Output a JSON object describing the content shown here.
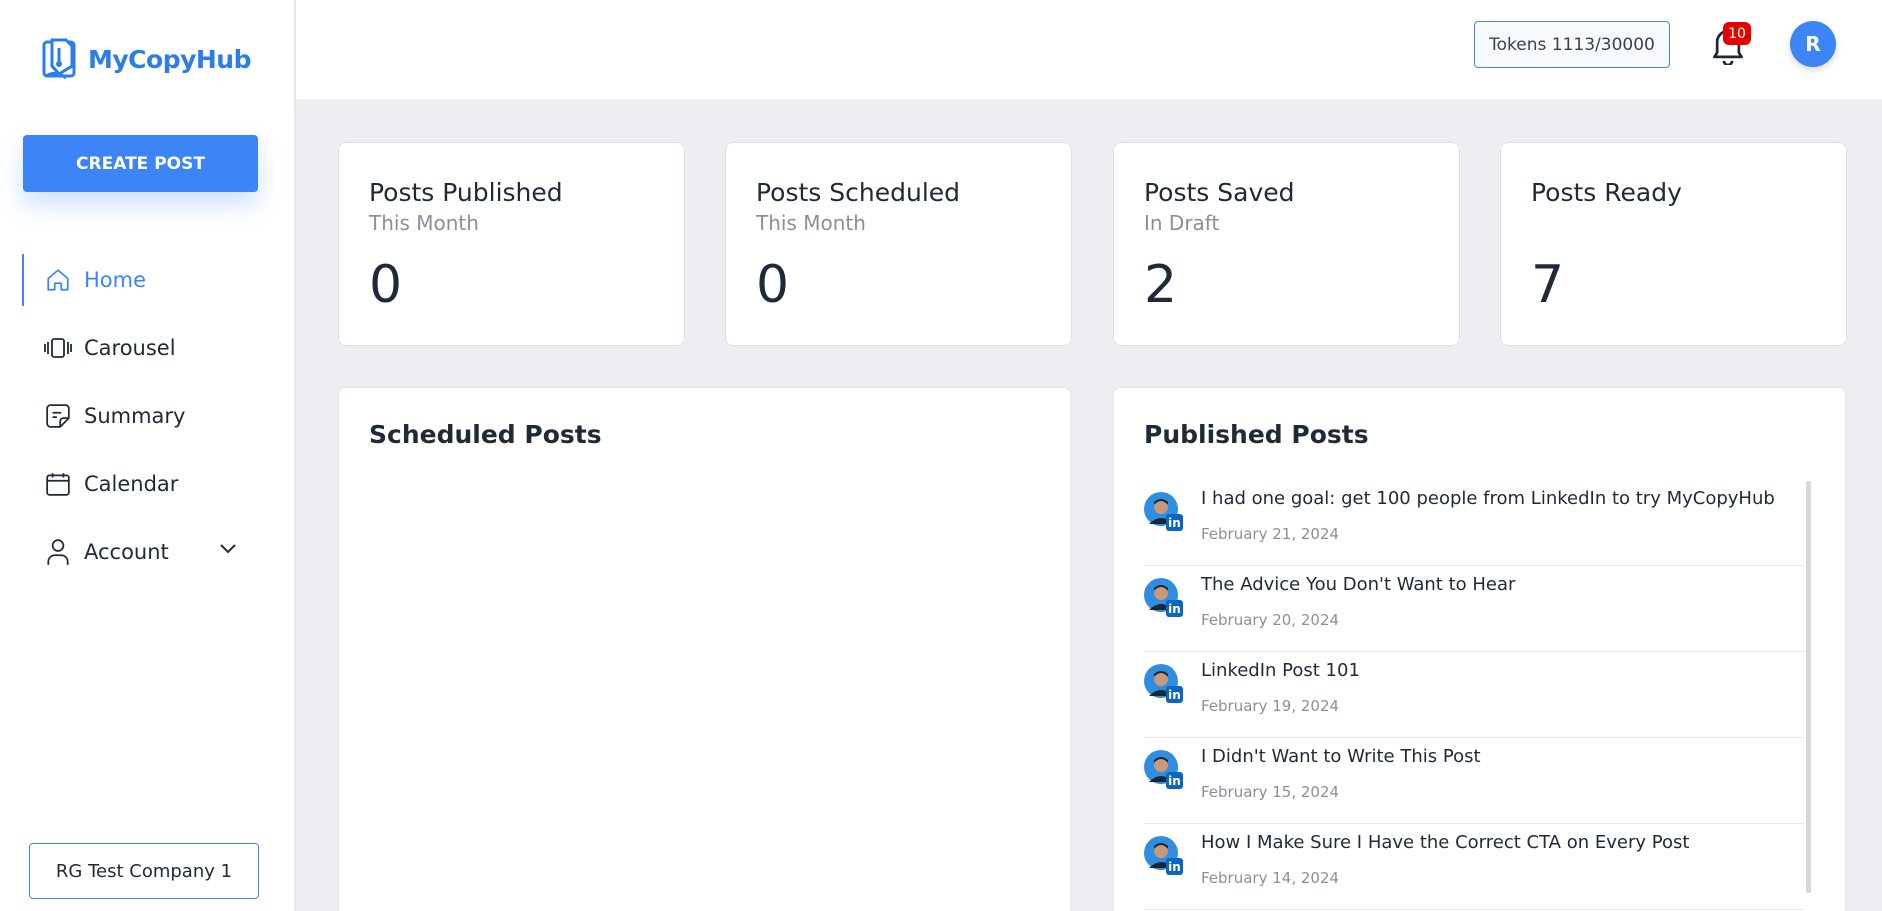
{
  "app": {
    "name": "MyCopyHub",
    "brand_color": "#2b7de9",
    "accent": "#3d84f7"
  },
  "sidebar": {
    "create_label": "CREATE POST",
    "items": [
      {
        "label": "Home",
        "icon": "home-icon",
        "active": true
      },
      {
        "label": "Carousel",
        "icon": "carousel-icon"
      },
      {
        "label": "Summary",
        "icon": "summary-icon"
      },
      {
        "label": "Calendar",
        "icon": "calendar-icon"
      },
      {
        "label": "Account",
        "icon": "user-icon",
        "expandable": true
      }
    ],
    "company": "RG Test Company 1"
  },
  "header": {
    "tokens": "Tokens 1113/30000",
    "notifications": "10",
    "avatar_initial": "R"
  },
  "stats": [
    {
      "title": "Posts Published",
      "subtitle": "This Month",
      "value": "0"
    },
    {
      "title": "Posts Scheduled",
      "subtitle": "This Month",
      "value": "0"
    },
    {
      "title": "Posts Saved",
      "subtitle": "In Draft",
      "value": "2"
    },
    {
      "title": "Posts Ready",
      "subtitle": "",
      "value": "7"
    }
  ],
  "scheduled": {
    "title": "Scheduled Posts"
  },
  "published": {
    "title": "Published Posts",
    "posts": [
      {
        "title": "I had one goal: get 100 people from LinkedIn to try MyCopyHub",
        "date": "February 21, 2024"
      },
      {
        "title": "The Advice You Don't Want to Hear",
        "date": "February 20, 2024"
      },
      {
        "title": "LinkedIn Post 101",
        "date": "February 19, 2024"
      },
      {
        "title": "I Didn't Want to Write This Post",
        "date": "February 15, 2024"
      },
      {
        "title": "How I Make Sure I Have the Correct CTA on Every Post",
        "date": "February 14, 2024"
      }
    ]
  }
}
